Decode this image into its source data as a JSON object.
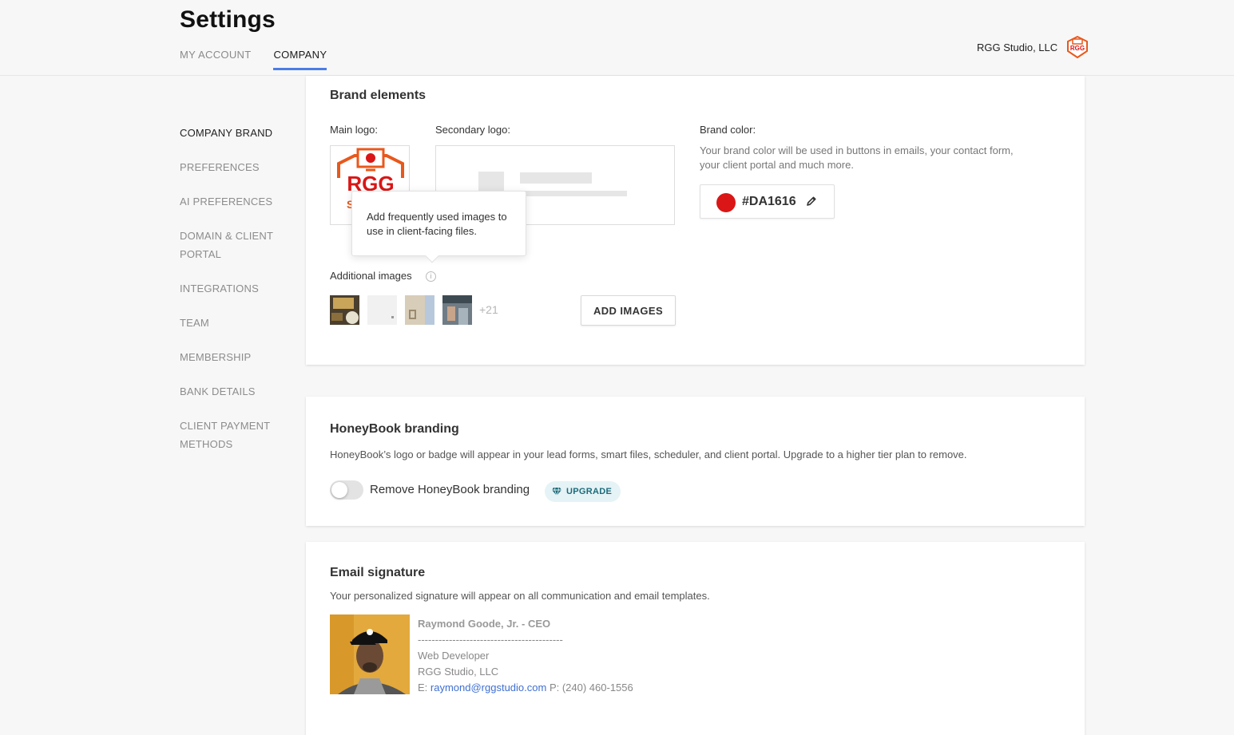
{
  "header": {
    "title": "Settings",
    "tabs": [
      "MY ACCOUNT",
      "COMPANY"
    ],
    "company_name": "RGG Studio, LLC"
  },
  "sidebar": {
    "items": [
      {
        "label": "COMPANY BRAND",
        "active": true
      },
      {
        "label": "PREFERENCES",
        "active": false
      },
      {
        "label": "AI PREFERENCES",
        "active": false
      },
      {
        "label": "DOMAIN & CLIENT PORTAL",
        "active": false
      },
      {
        "label": "INTEGRATIONS",
        "active": false
      },
      {
        "label": "TEAM",
        "active": false
      },
      {
        "label": "MEMBERSHIP",
        "active": false
      },
      {
        "label": "BANK DETAILS",
        "active": false
      },
      {
        "label": "CLIENT PAYMENT METHODS",
        "active": false
      }
    ]
  },
  "brand": {
    "title": "Brand elements",
    "main_logo_label": "Main logo:",
    "main_logo_text": "RGG",
    "main_logo_subtext": "S T",
    "secondary_logo_label": "Secondary logo:",
    "tooltip": "Add frequently used images to use in client-facing files.",
    "additional_images_label": "Additional images",
    "more_count": "+21",
    "add_images_button": "ADD IMAGES",
    "brand_color_label": "Brand color:",
    "brand_color_desc": "Your brand color will be used in buttons in emails, your contact form, your client portal and much more.",
    "brand_color_hex": "#DA1616"
  },
  "honeybook": {
    "title": "HoneyBook branding",
    "description": "HoneyBook’s logo or badge will appear in your lead forms, smart files, scheduler, and client portal. Upgrade to a higher tier plan to remove.",
    "toggle_label": "Remove HoneyBook branding",
    "toggle_on": false,
    "upgrade_label": "UPGRADE"
  },
  "signature": {
    "title": "Email signature",
    "description": "Your personalized signature will appear on all communication and email templates.",
    "name_line": "Raymond Goode, Jr. - CEO",
    "divider": "------------------------------------------",
    "role": "Web Developer",
    "company": "RGG Studio, LLC",
    "email_prefix": "E: ",
    "email": "raymond@rggstudio.com",
    "phone": " P: (240) 460-1556"
  },
  "colors": {
    "accent": "#4a7ee6",
    "brand": "#DA1616",
    "logo_orange": "#e8581c",
    "upgrade_bg": "#e5f3f6"
  }
}
